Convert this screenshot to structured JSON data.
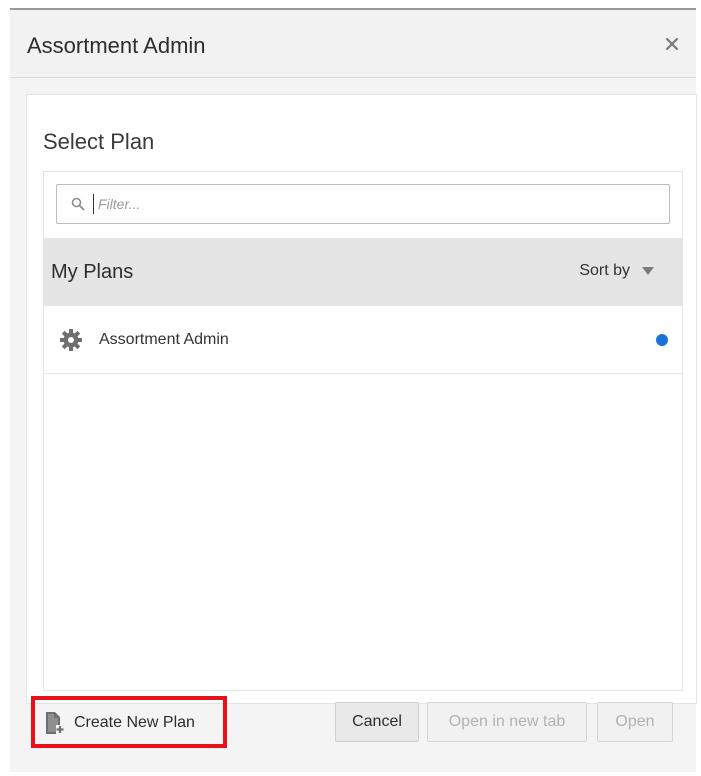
{
  "dialog": {
    "title": "Assortment Admin",
    "close_icon": "close-icon"
  },
  "panel": {
    "title": "Select Plan",
    "filter": {
      "placeholder": "Filter...",
      "value": "",
      "icon": "search-icon"
    },
    "group": {
      "title": "My Plans",
      "sort_label": "Sort by",
      "sort_icon": "caret-down-icon"
    },
    "items": [
      {
        "label": "Assortment Admin",
        "icon": "gear-icon",
        "indicator_color": "#1a73d6"
      }
    ]
  },
  "footer": {
    "create_label": "Create New Plan",
    "create_icon": "new-document-icon",
    "cancel_label": "Cancel",
    "open_new_tab_label": "Open in new tab",
    "open_label": "Open"
  },
  "colors": {
    "highlight": "#e8101a",
    "accent": "#1a73d6",
    "group_header_bg": "#e5e5e5"
  }
}
